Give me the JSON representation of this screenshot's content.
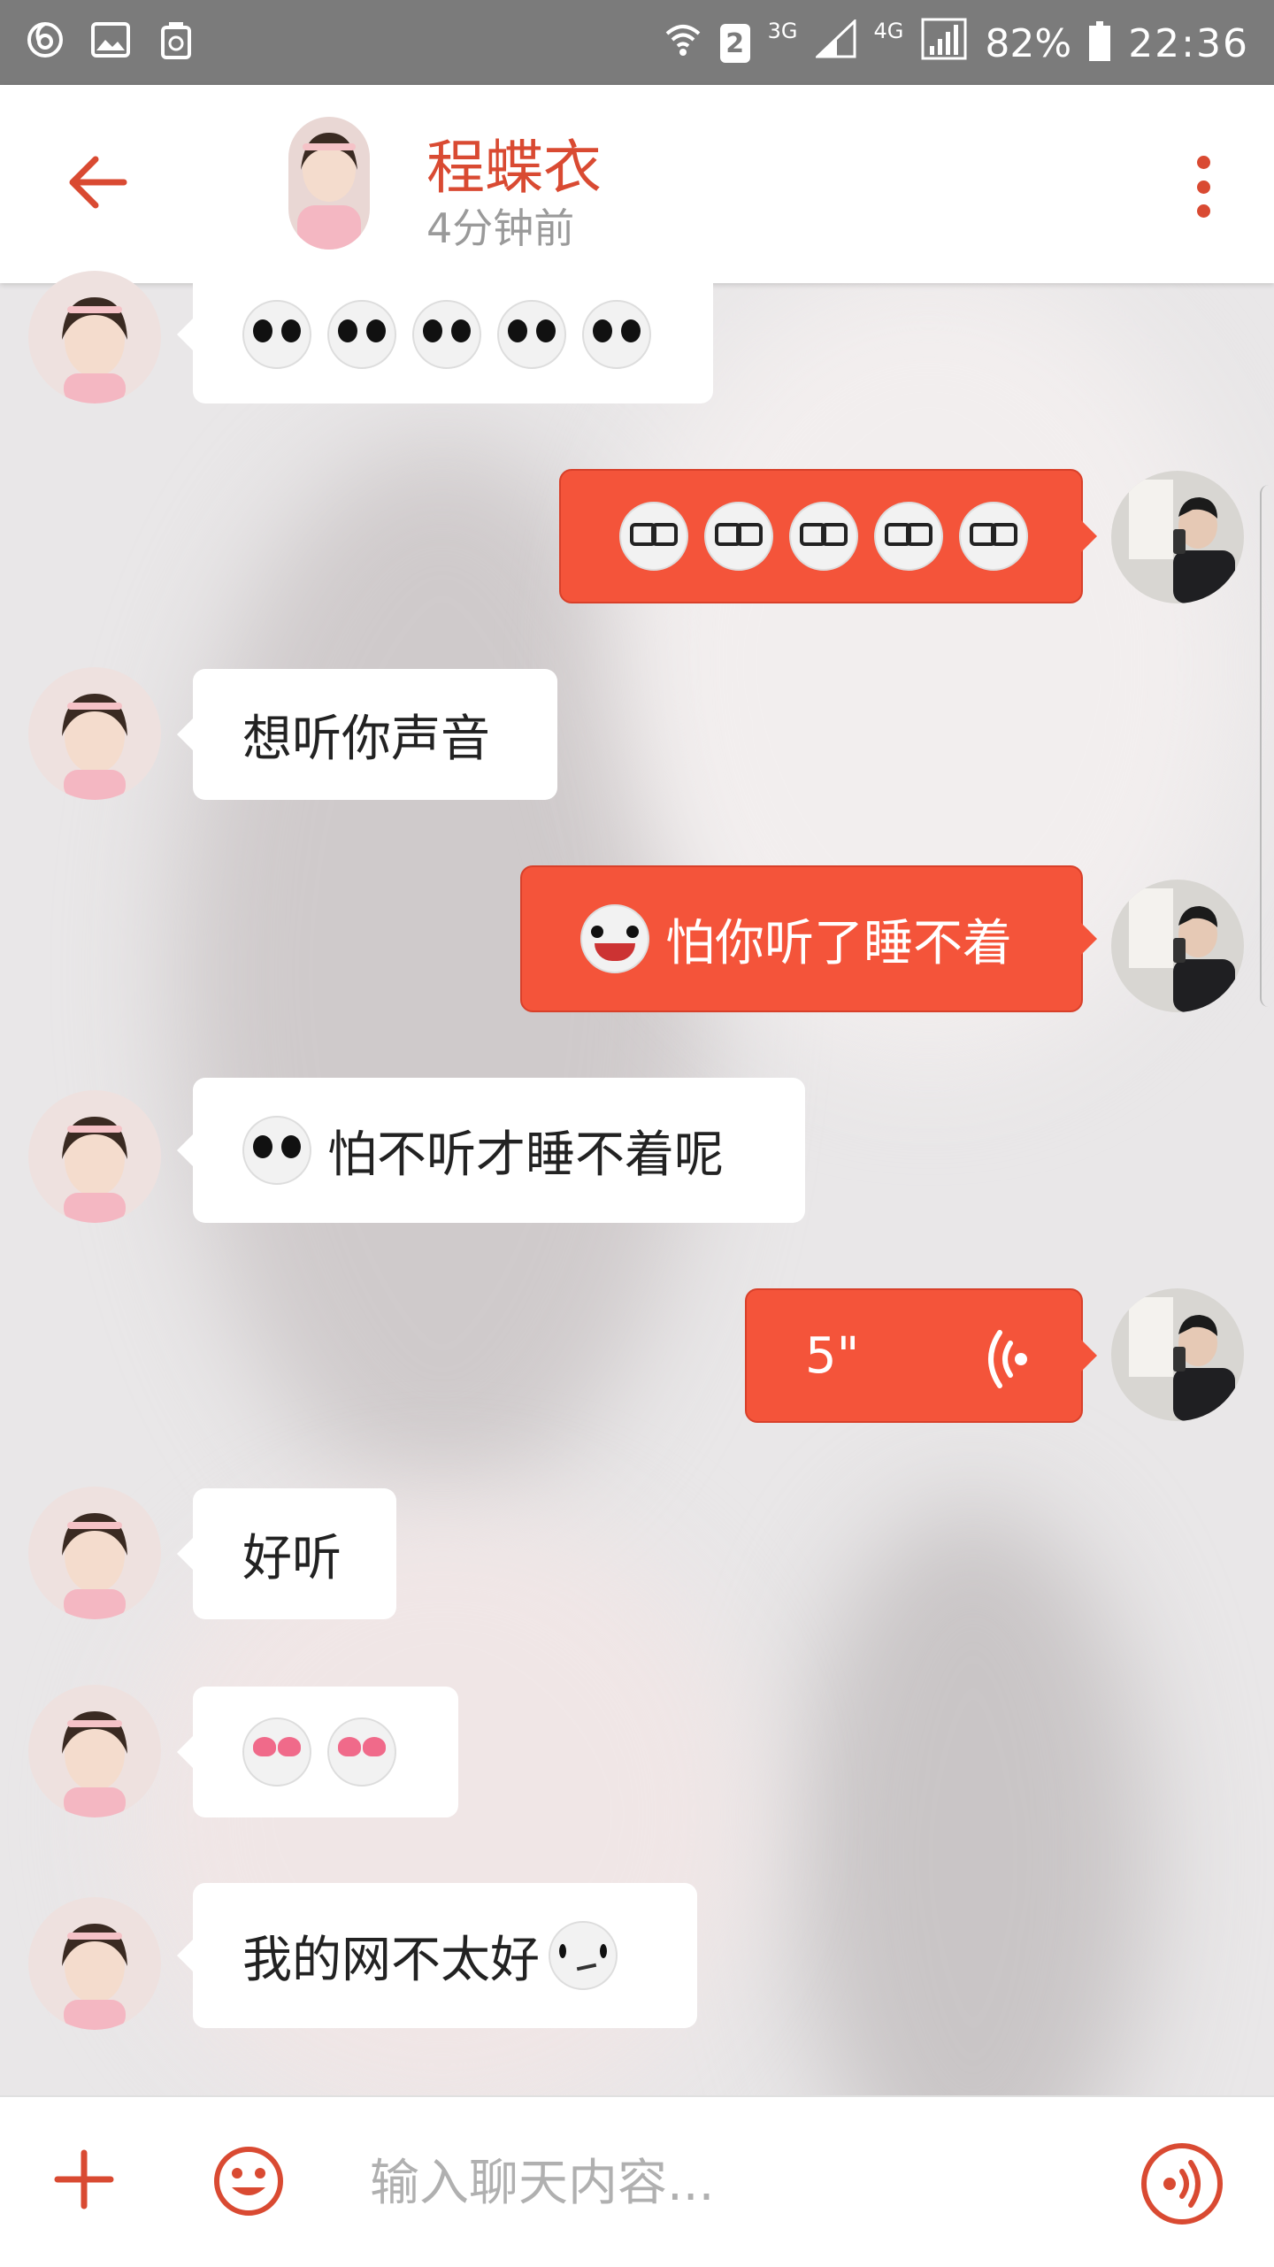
{
  "status_bar": {
    "net_3g": "3G",
    "net_4g": "4G",
    "sim": "2",
    "battery": "82%",
    "time": "22:36"
  },
  "header": {
    "name": "程蝶衣",
    "last_seen": "4分钟前"
  },
  "messages": [
    {
      "side": "in",
      "text": "",
      "emoji": [
        "sunglasses",
        "sunglasses",
        "sunglasses",
        "sunglasses",
        "sunglasses"
      ]
    },
    {
      "side": "out",
      "text": "",
      "emoji": [
        "glasses",
        "glasses",
        "glasses",
        "glasses",
        "glasses"
      ]
    },
    {
      "side": "in",
      "text": "想听你声音"
    },
    {
      "side": "out",
      "text": "怕你听了睡不着",
      "emoji": [
        "grin"
      ]
    },
    {
      "side": "in",
      "text": "怕不听才睡不着呢",
      "emoji": [
        "sunglasses"
      ]
    },
    {
      "side": "out",
      "voice": "5\""
    },
    {
      "side": "in",
      "text": "好听"
    },
    {
      "side": "in",
      "text": "",
      "emoji": [
        "heart-eyes",
        "heart-eyes"
      ]
    },
    {
      "side": "in",
      "text": "我的网不太好",
      "emoji_after": [
        "meh"
      ]
    }
  ],
  "composer": {
    "placeholder": "输入聊天内容..."
  },
  "colors": {
    "accent": "#d94a32",
    "bubble_out": "#f4543a",
    "bubble_in": "#ffffff"
  }
}
